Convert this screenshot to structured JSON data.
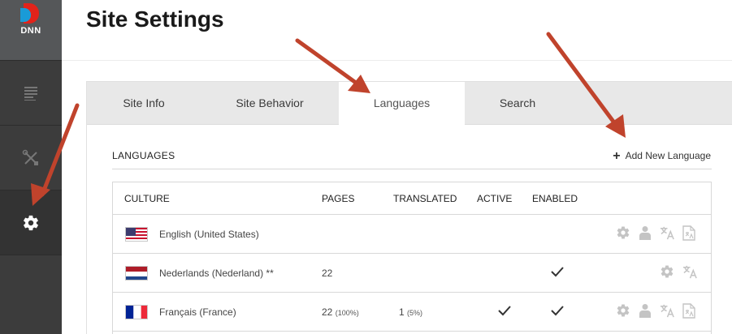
{
  "sidebar": {
    "logo_text": "DNN",
    "items": [
      {
        "icon": "content-icon"
      },
      {
        "icon": "tools-icon"
      },
      {
        "icon": "gear-icon",
        "active": true
      }
    ]
  },
  "header": {
    "title": "Site Settings"
  },
  "tabs": [
    {
      "label": "Site Info"
    },
    {
      "label": "Site Behavior"
    },
    {
      "label": "Languages",
      "active": true
    },
    {
      "label": "Search"
    }
  ],
  "languages": {
    "section_title": "LANGUAGES",
    "add_label": "Add New Language",
    "columns": [
      "CULTURE",
      "PAGES",
      "TRANSLATED",
      "ACTIVE",
      "ENABLED"
    ],
    "rows": [
      {
        "flag": "us",
        "culture": "English (United States)",
        "pages": "",
        "pages_pct": "",
        "translated": "",
        "translated_pct": "",
        "active": false,
        "enabled": false,
        "actions": [
          "gear-icon",
          "user-icon",
          "translate-icon",
          "translate-page-icon"
        ]
      },
      {
        "flag": "nl",
        "culture": "Nederlands (Nederland) **",
        "pages": "22",
        "pages_pct": "",
        "translated": "",
        "translated_pct": "",
        "active": false,
        "enabled": true,
        "actions": [
          "gear-icon",
          "translate-icon"
        ]
      },
      {
        "flag": "fr",
        "culture": "Français (France)",
        "pages": "22",
        "pages_pct": "(100%)",
        "translated": "1",
        "translated_pct": "(5%)",
        "active": true,
        "enabled": true,
        "actions": [
          "gear-icon",
          "user-icon",
          "translate-icon",
          "translate-page-icon"
        ]
      }
    ]
  },
  "colors": {
    "sidebar": "#3c3c3c",
    "logo_red": "#e2231a",
    "logo_blue": "#1a9bd7",
    "tab_bar": "#e8e8e8",
    "icon_gray": "#c4c4c4",
    "arrow": "#c0432c"
  }
}
